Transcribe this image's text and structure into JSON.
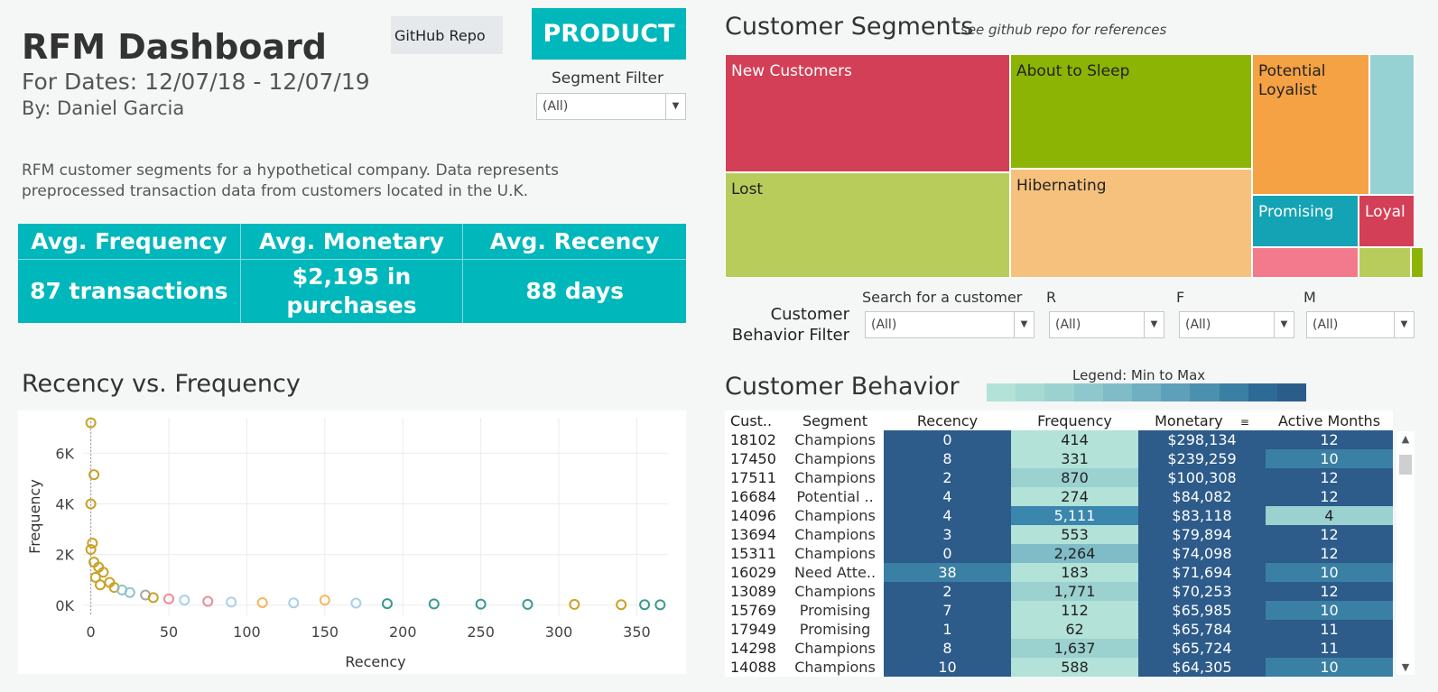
{
  "header": {
    "title": "RFM Dashboard",
    "dates": "For Dates: 12/07/18 - 12/07/19",
    "author": "By: Daniel Garcia",
    "github_button": "GitHub Repo",
    "product_button": "PRODUCT",
    "segment_filter_label": "Segment Filter",
    "segment_filter_value": "(All)",
    "description": "RFM customer segments for a hypothetical company. Data represents preprocessed transaction data from customers located in the  U.K."
  },
  "kpis": [
    {
      "label": "Avg. Frequency",
      "value": "87 transactions"
    },
    {
      "label": "Avg. Monetary",
      "value": "$2,195 in purchases"
    },
    {
      "label": "Avg. Recency",
      "value": "88 days"
    }
  ],
  "colors": {
    "accent": "#00b7bb",
    "dark_blue": "#2d5b8a",
    "light_teal": "#b2e2d8"
  },
  "scatter": {
    "title": "Recency vs. Frequency",
    "chart_data": {
      "type": "scatter",
      "xlabel": "Recency",
      "ylabel": "Frequency",
      "xlim": [
        -5,
        370
      ],
      "ylim": [
        -400,
        7400
      ],
      "x_ticks": [
        {
          "v": 0,
          "l": "0"
        },
        {
          "v": 50,
          "l": "50"
        },
        {
          "v": 100,
          "l": "100"
        },
        {
          "v": 150,
          "l": "150"
        },
        {
          "v": 200,
          "l": "200"
        },
        {
          "v": 250,
          "l": "250"
        },
        {
          "v": 300,
          "l": "300"
        },
        {
          "v": 350,
          "l": "350"
        }
      ],
      "y_ticks": [
        {
          "v": 0,
          "l": "0K"
        },
        {
          "v": 2000,
          "l": "2K"
        },
        {
          "v": 4000,
          "l": "4K"
        },
        {
          "v": 6000,
          "l": "6K"
        }
      ],
      "points": [
        {
          "x": 0,
          "y": 7200,
          "c": "#c9a227"
        },
        {
          "x": 2,
          "y": 5150,
          "c": "#c9a227"
        },
        {
          "x": 0,
          "y": 4000,
          "c": "#c9a227"
        },
        {
          "x": 1,
          "y": 2450,
          "c": "#c9a227"
        },
        {
          "x": 0,
          "y": 2200,
          "c": "#c9a227"
        },
        {
          "x": 2,
          "y": 1700,
          "c": "#c9a227"
        },
        {
          "x": 5,
          "y": 1500,
          "c": "#c9a227"
        },
        {
          "x": 8,
          "y": 1300,
          "c": "#c9a227"
        },
        {
          "x": 3,
          "y": 1100,
          "c": "#c9a227"
        },
        {
          "x": 12,
          "y": 900,
          "c": "#c9a227"
        },
        {
          "x": 6,
          "y": 800,
          "c": "#c9a227"
        },
        {
          "x": 15,
          "y": 700,
          "c": "#c9a227"
        },
        {
          "x": 20,
          "y": 600,
          "c": "#8ec4c9"
        },
        {
          "x": 25,
          "y": 500,
          "c": "#8ec4c9"
        },
        {
          "x": 35,
          "y": 400,
          "c": "#a8a8a8"
        },
        {
          "x": 40,
          "y": 300,
          "c": "#c9a227"
        },
        {
          "x": 50,
          "y": 250,
          "c": "#f08a96"
        },
        {
          "x": 60,
          "y": 200,
          "c": "#a8d0ea"
        },
        {
          "x": 75,
          "y": 150,
          "c": "#f08a96"
        },
        {
          "x": 90,
          "y": 120,
          "c": "#a8d0ea"
        },
        {
          "x": 110,
          "y": 100,
          "c": "#f4b860"
        },
        {
          "x": 130,
          "y": 90,
          "c": "#a8d0ea"
        },
        {
          "x": 150,
          "y": 200,
          "c": "#f4b860"
        },
        {
          "x": 170,
          "y": 80,
          "c": "#a8d0ea"
        },
        {
          "x": 190,
          "y": 60,
          "c": "#3a9a8f"
        },
        {
          "x": 220,
          "y": 50,
          "c": "#3a9a8f"
        },
        {
          "x": 250,
          "y": 40,
          "c": "#3a9a8f"
        },
        {
          "x": 280,
          "y": 30,
          "c": "#3a9a8f"
        },
        {
          "x": 310,
          "y": 30,
          "c": "#c9a227"
        },
        {
          "x": 340,
          "y": 20,
          "c": "#c9a227"
        },
        {
          "x": 355,
          "y": 20,
          "c": "#3a9a8f"
        },
        {
          "x": 365,
          "y": 15,
          "c": "#3a9a8f"
        }
      ]
    }
  },
  "segments": {
    "title": "Customer Segments",
    "subtitle": "see github repo for references",
    "tiles": [
      {
        "label": "New Customers",
        "color": "#d33f56"
      },
      {
        "label": "About to Sleep",
        "color": "#8cb404"
      },
      {
        "label": "Potential Loyalist",
        "color": "#f5a244"
      },
      {
        "label": "",
        "color": "#96d2d4"
      },
      {
        "label": "Lost",
        "color": "#b8cc5c"
      },
      {
        "label": "Hibernating",
        "color": "#f6c17c"
      },
      {
        "label": "Promising",
        "color": "#13a3b4"
      },
      {
        "label": "Loyal",
        "color": "#d33f56"
      },
      {
        "label": "",
        "color": "#f27a8c"
      },
      {
        "label": "",
        "color": "#b8cc5c"
      },
      {
        "label": "",
        "color": "#8cb404"
      }
    ]
  },
  "behavior_filter": {
    "label": "Customer Behavior Filter",
    "search_label": "Search for a customer",
    "search_value": "(All)",
    "r_label": "R",
    "r_value": "(All)",
    "f_label": "F",
    "f_value": "(All)",
    "m_label": "M",
    "m_value": "(All)"
  },
  "behavior": {
    "title": "Customer Behavior",
    "legend_label": "Legend: Min to Max",
    "legend_colors": [
      "#b2e2d8",
      "#a7dad3",
      "#9bd1cf",
      "#8ec8cc",
      "#80bcc7",
      "#70afc2",
      "#5ea0ba",
      "#4c90b0",
      "#3a7fa4",
      "#2d6b96",
      "#2a5d8a"
    ],
    "columns": [
      "Cust..",
      "Segment",
      "Recency",
      "Frequency",
      "Monetary",
      "Active Months"
    ],
    "rows": [
      [
        "18102",
        "Champions",
        "0",
        "414",
        "$298,134",
        "12"
      ],
      [
        "17450",
        "Champions",
        "8",
        "331",
        "$239,259",
        "10"
      ],
      [
        "17511",
        "Champions",
        "2",
        "870",
        "$100,308",
        "12"
      ],
      [
        "16684",
        "Potential ..",
        "4",
        "274",
        "$84,082",
        "12"
      ],
      [
        "14096",
        "Champions",
        "4",
        "5,111",
        "$83,118",
        "4"
      ],
      [
        "13694",
        "Champions",
        "3",
        "553",
        "$79,894",
        "12"
      ],
      [
        "15311",
        "Champions",
        "0",
        "2,264",
        "$74,098",
        "12"
      ],
      [
        "16029",
        "Need Atte..",
        "38",
        "183",
        "$71,694",
        "10"
      ],
      [
        "13089",
        "Champions",
        "2",
        "1,771",
        "$70,253",
        "12"
      ],
      [
        "15769",
        "Promising",
        "7",
        "112",
        "$65,985",
        "10"
      ],
      [
        "17949",
        "Promising",
        "1",
        "62",
        "$65,784",
        "11"
      ],
      [
        "14298",
        "Champions",
        "8",
        "1,637",
        "$65,724",
        "11"
      ],
      [
        "14088",
        "Champions",
        "10",
        "588",
        "$64,305",
        "10"
      ]
    ],
    "cell_colors": [
      [
        "#2d5b8a",
        "#b2e2d8",
        "#2d5b8a",
        "#2d5b8a"
      ],
      [
        "#2d5b8a",
        "#b2e2d8",
        "#2d5b8a",
        "#3a7fa4"
      ],
      [
        "#2d5b8a",
        "#9bd1cf",
        "#2d5b8a",
        "#2d5b8a"
      ],
      [
        "#2d5b8a",
        "#b2e2d8",
        "#2d5b8a",
        "#2d5b8a"
      ],
      [
        "#2d5b8a",
        "#3a86ad",
        "#2d5b8a",
        "#9bd1cf"
      ],
      [
        "#2d5b8a",
        "#b2e2d8",
        "#2d5b8a",
        "#2d5b8a"
      ],
      [
        "#2d5b8a",
        "#80bcc7",
        "#2d5b8a",
        "#2d5b8a"
      ],
      [
        "#3a7fa4",
        "#b2e2d8",
        "#2d5b8a",
        "#3a7fa4"
      ],
      [
        "#2d5b8a",
        "#9bd1cf",
        "#2d5b8a",
        "#2d5b8a"
      ],
      [
        "#2d5b8a",
        "#b2e2d8",
        "#2d5b8a",
        "#3a7fa4"
      ],
      [
        "#2d5b8a",
        "#b2e2d8",
        "#2d5b8a",
        "#2d5b8a"
      ],
      [
        "#2d5b8a",
        "#9bd1cf",
        "#2d5b8a",
        "#2d5b8a"
      ],
      [
        "#2d5b8a",
        "#b2e2d8",
        "#2d5b8a",
        "#3a7fa4"
      ]
    ]
  }
}
